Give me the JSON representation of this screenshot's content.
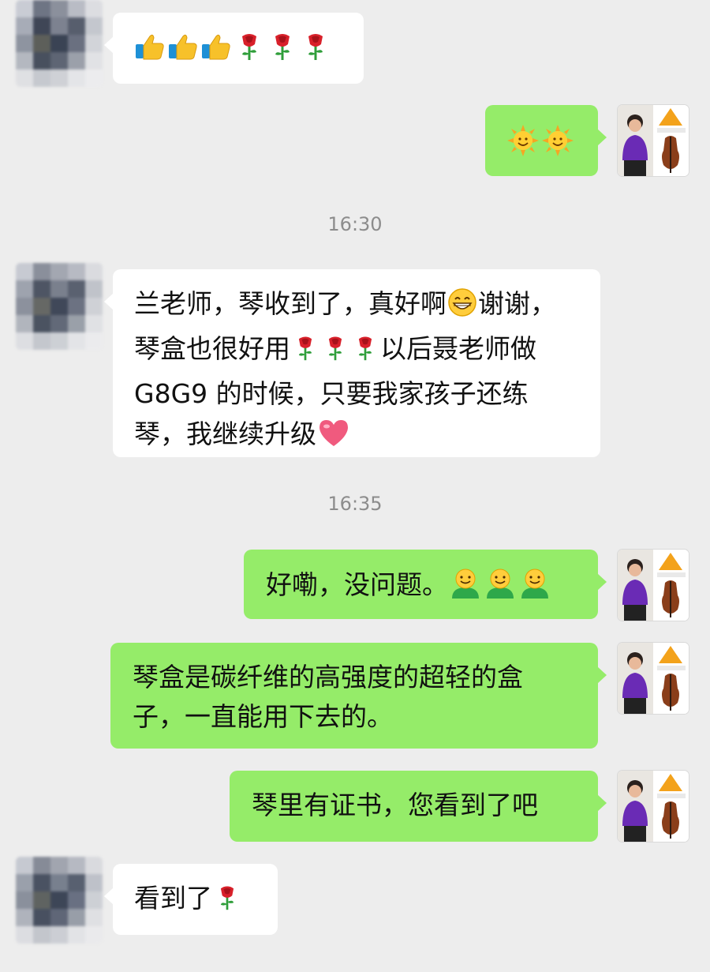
{
  "timestamps": [
    "16:30",
    "16:35"
  ],
  "messages": [
    {
      "sender": "other",
      "emojis": [
        "thumbs-up",
        "thumbs-up",
        "thumbs-up",
        "rose",
        "rose",
        "rose"
      ]
    },
    {
      "sender": "me",
      "emojis": [
        "sun-face",
        "sun-face"
      ]
    },
    {
      "sender": "other",
      "lines": {
        "l1a": "兰老师，琴收到了，真好啊",
        "l1b": "谢谢，",
        "l2a": "琴盒也很好用",
        "l2b": "以后聂老师做",
        "l3": "G8G9 的时候，只要我家孩子还练",
        "l4": "琴，我继续升级"
      }
    },
    {
      "sender": "me",
      "text": "好嘞，没问题。"
    },
    {
      "sender": "me",
      "lines": {
        "l1": "琴盒是碳纤维的高强度的超轻的盒",
        "l2": "子，一直能用下去的。"
      }
    },
    {
      "sender": "me",
      "text": "琴里有证书，您看到了吧"
    },
    {
      "sender": "other",
      "text": "看到了"
    }
  ],
  "colors": {
    "background": "#ededed",
    "bubble_me": "#95ec69",
    "bubble_other": "#ffffff",
    "timestamp": "#8c8c8c"
  }
}
